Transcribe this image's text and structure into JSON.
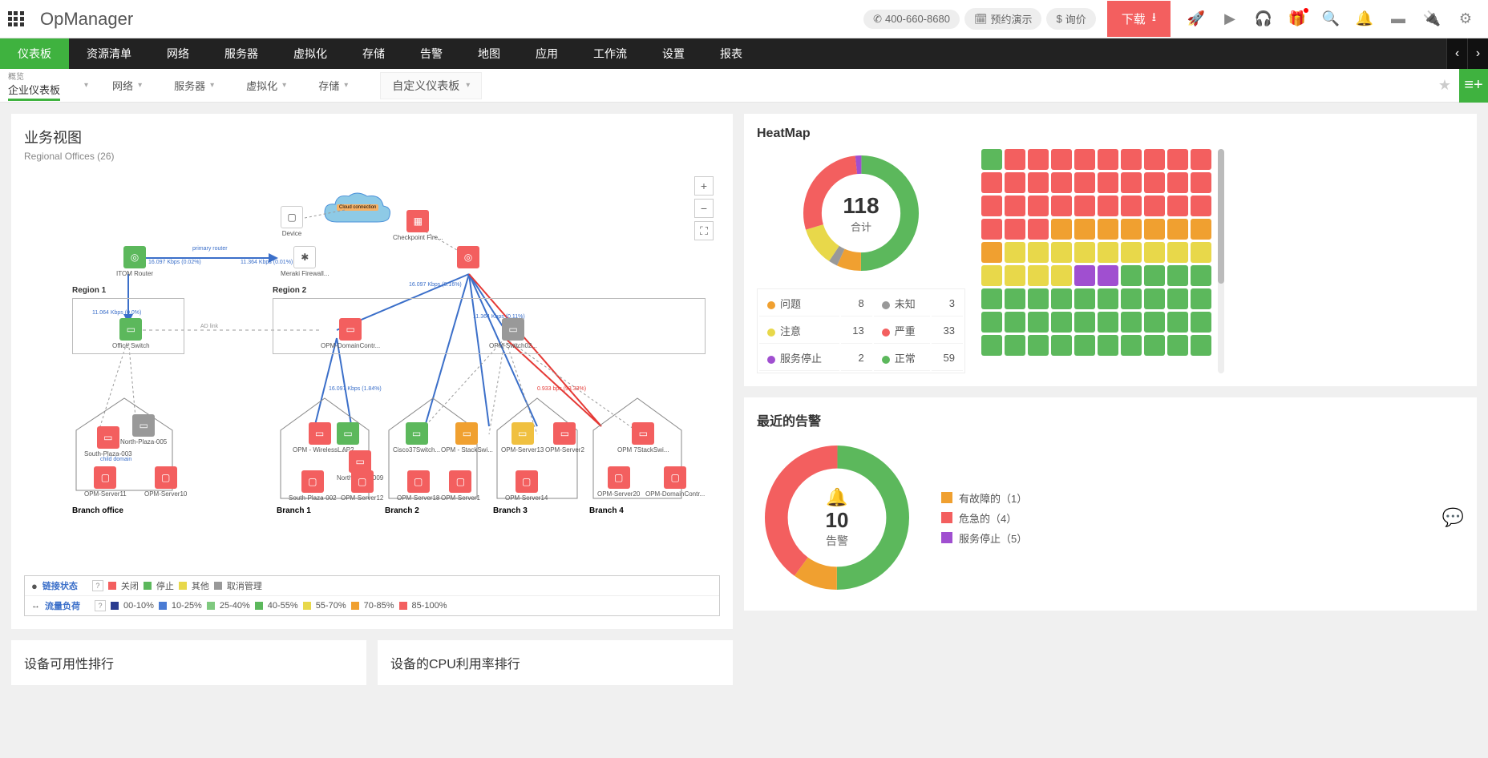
{
  "brand": "OpManager",
  "topbar": {
    "phone": "400-660-8680",
    "demo": "预约演示",
    "quote": "询价",
    "download": "下载"
  },
  "mainnav": [
    "仪表板",
    "资源清单",
    "网络",
    "服务器",
    "虚拟化",
    "存储",
    "告警",
    "地图",
    "应用",
    "工作流",
    "设置",
    "报表"
  ],
  "subnav": {
    "overview_tiny": "概览",
    "overview_label": "企业仪表板",
    "items": [
      "网络",
      "服务器",
      "虚拟化",
      "存储"
    ],
    "custom": "自定义仪表板"
  },
  "business_view": {
    "title": "业务视图",
    "subtitle": "Regional Offices (26)",
    "regions": {
      "r1": "Region 1",
      "r2": "Region 2"
    },
    "branches": {
      "bo": "Branch office",
      "b1": "Branch 1",
      "b2": "Branch 2",
      "b3": "Branch 3",
      "b4": "Branch 4"
    },
    "nodes": {
      "itom_router": "ITOM Router",
      "device": "Device",
      "meraki": "Meraki Firewall...",
      "checkpoint": "Checkpoint Fire...",
      "office_switch": "Office Switch",
      "opm_dc": "OPM-DomainContr...",
      "opm_switch": "OPM-Switch02...",
      "south_plaza_003": "South-Plaza-003",
      "north_plaza_005": "North-Plaza-005",
      "child_domain": "child domain",
      "opm_server11": "OPM-Server11",
      "opm_server10": "OPM-Server10",
      "opm_wireless": "OPM - WirelessL...",
      "south_plaza_002": "South-Plaza-002",
      "north_plaza_009": "North-Plaza-009",
      "opm_server12": "OPM-Server12",
      "ap2": "AP2",
      "cisco37": "Cisco37Switch...",
      "opm_stackswi": "OPM - StackSwi...",
      "opm_server18": "OPM-Server18",
      "opm_server1": "OPM-Server1",
      "opm_server13": "OPM-Server13",
      "opm_server14": "OPM-Server14",
      "opm_server2": "OPM-Server2",
      "opm_7stack": "OPM 7StackSwi...",
      "opm_server20": "OPM-Server20",
      "opm_dc2": "OPM-DomainContr..."
    },
    "cloud_label": "Cloud connection",
    "links": {
      "primary_router": "primary router",
      "ad_link": "AD link",
      "r1_traffic": "11.064 Kbps (0.0%)",
      "kb_1": "16.097 Kbps (0.02%)",
      "kb_2": "11.364 Kbps (0.01%)",
      "kb_3": "16.097 Kbps (0.16%)",
      "kb_4": "11.364 Kbps (0.11%)",
      "kb_5": "0.933 bps (93.33%)",
      "kb_6": "16.097 Kbps (1.84%)"
    },
    "legend": {
      "link_status": "链接状态",
      "traffic_load": "流量负荷",
      "closed": "关闭",
      "stopped": "停止",
      "other": "其他",
      "unmanaged": "取消管理",
      "ranges": [
        "00-10%",
        "10-25%",
        "25-40%",
        "40-55%",
        "55-70%",
        "70-85%",
        "85-100%"
      ]
    }
  },
  "bottom_panels": {
    "avail": "设备可用性排行",
    "cpu": "设备的CPU利用率排行"
  },
  "heatmap": {
    "title": "HeatMap",
    "total_num": "118",
    "total_lbl": "合计",
    "legend": [
      {
        "color": "#f0a030",
        "label": "问题",
        "count": 8
      },
      {
        "color": "#999",
        "label": "未知",
        "count": 3
      },
      {
        "color": "#e8d84a",
        "label": "注意",
        "count": 13
      },
      {
        "color": "#f35f5f",
        "label": "严重",
        "count": 33
      },
      {
        "color": "#a04fd0",
        "label": "服务停止",
        "count": 2
      },
      {
        "color": "#5cb85c",
        "label": "正常",
        "count": 59
      }
    ],
    "chart_data": {
      "type": "pie",
      "title": "HeatMap 合计 118",
      "series": [
        {
          "name": "问题",
          "value": 8,
          "color": "#f0a030"
        },
        {
          "name": "未知",
          "value": 3,
          "color": "#999"
        },
        {
          "name": "注意",
          "value": 13,
          "color": "#e8d84a"
        },
        {
          "name": "严重",
          "value": 33,
          "color": "#f35f5f"
        },
        {
          "name": "服务停止",
          "value": 2,
          "color": "#a04fd0"
        },
        {
          "name": "正常",
          "value": 59,
          "color": "#5cb85c"
        }
      ]
    },
    "grid_colors": [
      "#5cb85c",
      "#f35f5f",
      "#f35f5f",
      "#f35f5f",
      "#f35f5f",
      "#f35f5f",
      "#f35f5f",
      "#f35f5f",
      "#f35f5f",
      "#f35f5f",
      "#f35f5f",
      "#f35f5f",
      "#f35f5f",
      "#f35f5f",
      "#f35f5f",
      "#f35f5f",
      "#f35f5f",
      "#f35f5f",
      "#f35f5f",
      "#f35f5f",
      "#f35f5f",
      "#f35f5f",
      "#f35f5f",
      "#f35f5f",
      "#f35f5f",
      "#f35f5f",
      "#f35f5f",
      "#f35f5f",
      "#f35f5f",
      "#f35f5f",
      "#f35f5f",
      "#f35f5f",
      "#f35f5f",
      "#f0a030",
      "#f0a030",
      "#f0a030",
      "#f0a030",
      "#f0a030",
      "#f0a030",
      "#f0a030",
      "#f0a030",
      "#e8d84a",
      "#e8d84a",
      "#e8d84a",
      "#e8d84a",
      "#e8d84a",
      "#e8d84a",
      "#e8d84a",
      "#e8d84a",
      "#e8d84a",
      "#e8d84a",
      "#e8d84a",
      "#e8d84a",
      "#e8d84a",
      "#a04fd0",
      "#a04fd0",
      "#5cb85c",
      "#5cb85c",
      "#5cb85c",
      "#5cb85c",
      "#5cb85c",
      "#5cb85c",
      "#5cb85c",
      "#5cb85c",
      "#5cb85c",
      "#5cb85c",
      "#5cb85c",
      "#5cb85c",
      "#5cb85c",
      "#5cb85c",
      "#5cb85c",
      "#5cb85c",
      "#5cb85c",
      "#5cb85c",
      "#5cb85c",
      "#5cb85c",
      "#5cb85c",
      "#5cb85c",
      "#5cb85c",
      "#5cb85c",
      "#5cb85c",
      "#5cb85c",
      "#5cb85c",
      "#5cb85c",
      "#5cb85c",
      "#5cb85c",
      "#5cb85c",
      "#5cb85c",
      "#5cb85c",
      "#5cb85c"
    ]
  },
  "alarms": {
    "title": "最近的告警",
    "total_num": "10",
    "total_lbl": "告警",
    "legend": [
      {
        "color": "#f0a030",
        "label": "有故障的（1）"
      },
      {
        "color": "#f35f5f",
        "label": "危急的（4）"
      },
      {
        "color": "#a04fd0",
        "label": "服务停止（5）"
      }
    ],
    "chart_data": {
      "type": "pie",
      "title": "最近的告警 10",
      "series": [
        {
          "name": "有故障的",
          "value": 1,
          "color": "#f0a030"
        },
        {
          "name": "危急的",
          "value": 4,
          "color": "#f35f5f"
        },
        {
          "name": "服务停止",
          "value": 5,
          "color": "#a04fd0"
        }
      ]
    }
  }
}
